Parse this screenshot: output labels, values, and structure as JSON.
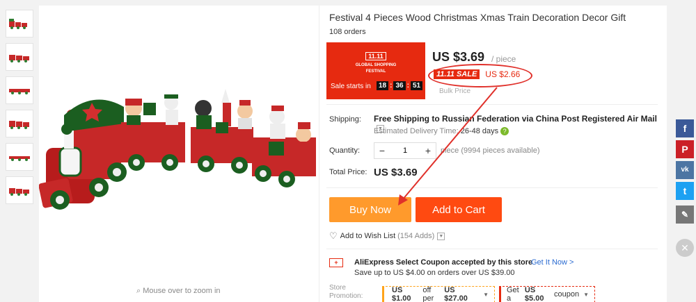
{
  "product": {
    "title": "Festival 4 Pieces Wood Christmas Xmas Train Decoration Decor Gift",
    "orders": "108 orders"
  },
  "promo": {
    "badge": "11.11",
    "festival_line1": "GLOBAL SHOPPING",
    "festival_line2": "FESTIVAL",
    "sale_starts": "Sale starts in",
    "timer": [
      "18",
      "36",
      "51"
    ],
    "color": "#e62a10"
  },
  "price": {
    "main": "US $3.69",
    "unit": "/ piece",
    "sale_badge": "11.11 SALE",
    "sale_price": "US $2.66",
    "bulk": "Bulk Price"
  },
  "shipping": {
    "label": "Shipping:",
    "value": "Free Shipping to Russian Federation via China Post Registered Air Mail",
    "delivery_label": "Estimated Delivery Time:",
    "delivery_value": "26-48 days",
    "help_icon": "?"
  },
  "quantity": {
    "label": "Quantity:",
    "value": "1",
    "minus": "−",
    "plus": "+",
    "available": "piece (9994 pieces available)"
  },
  "total": {
    "label": "Total Price:",
    "value": "US $3.69"
  },
  "buttons": {
    "buy_now": "Buy Now",
    "add_to_cart": "Add to Cart",
    "buy_color": "#ff9a2c",
    "cart_color": "#ff4a11"
  },
  "wishlist": {
    "label": "Add to Wish List",
    "count": "(154 Adds)"
  },
  "coupon": {
    "title": "AliExpress Select Coupon accepted by this store",
    "link": "Get It Now >",
    "sub": "Save up to US $4.00 on orders over US $39.00"
  },
  "store_promotion": {
    "label_line1": "Store",
    "label_line2": "Promotion:",
    "chip1_a": "US $1.00",
    "chip1_b": "off per",
    "chip1_c": "US $27.00",
    "chip2_a": "Get a",
    "chip2_b": "US $5.00",
    "chip2_c": "coupon"
  },
  "zoom_hint": "Mouse over to zoom in",
  "social": {
    "facebook": "f",
    "pinterest": "P",
    "vk": "vk",
    "twitter": "t",
    "edit": "✎",
    "close": "✕"
  }
}
